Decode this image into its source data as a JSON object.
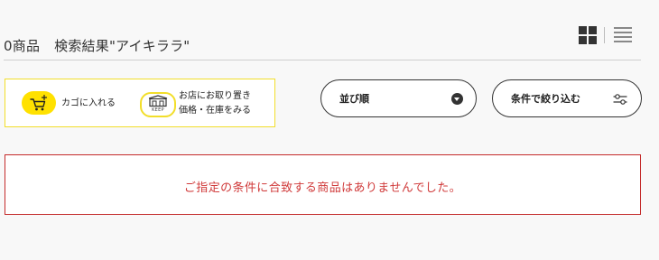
{
  "results": {
    "count": "0商品",
    "query_label": "検索結果\"アイキララ\""
  },
  "view_toggle": {
    "grid_icon": "grid-view-icon",
    "list_icon": "list-view-icon",
    "selected": "grid"
  },
  "legend": {
    "cart_icon": "cart-plus-icon",
    "cart_label": "カゴに入れる",
    "keep_icon": "keep-store-icon",
    "keep_badge_text": "KEEP",
    "keep_label_line1": "お店にお取り置き",
    "keep_label_line2": "価格・在庫をみる",
    "border_color": "#f2de2a",
    "badge_color": "#ffe100"
  },
  "sort": {
    "label": "並び順",
    "icon": "chevron-down-circle-icon"
  },
  "filter": {
    "label": "条件で絞り込む",
    "icon": "sliders-icon"
  },
  "notice": {
    "message": "ご指定の条件に合致する商品はありませんでした。",
    "border_color": "#c42b2b",
    "text_color": "#d03a3a"
  }
}
